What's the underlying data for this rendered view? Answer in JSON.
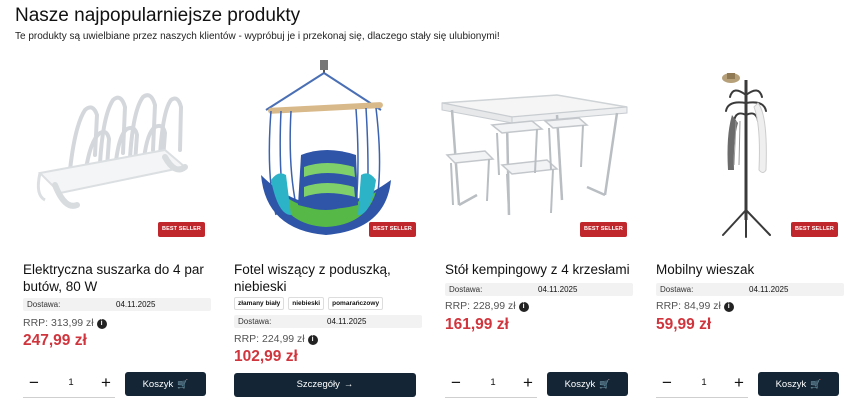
{
  "section": {
    "title": "Nasze najpopularniejsze produkty",
    "subtitle": "Te produkty są uwielbiane przez naszych klientów - wypróbuj je i przekonaj się, dlaczego stały się ulubionymi!"
  },
  "products": [
    {
      "title": "Elektryczna suszarka do 4 par butów, 80 W",
      "badge": "BEST SELLER",
      "delivery_label": "Dostawa:",
      "delivery_date": "04.11.2025",
      "rrp": "RRP: 313,99 zł",
      "price": "247,99 zł",
      "quantity": "1",
      "cart_label": "Koszyk",
      "image_icon": "shoe-dryer-image"
    },
    {
      "title": "Fotel wiszący z poduszką, niebieski",
      "badge": "BEST SELLER",
      "tags": [
        "złamany biały",
        "niebieski",
        "pomarańczowy"
      ],
      "delivery_label": "Dostawa:",
      "delivery_date": "04.11.2025",
      "rrp": "RRP: 224,99 zł",
      "price": "102,99 zł",
      "details_label": "Szczegóły",
      "image_icon": "hanging-chair-image"
    },
    {
      "title": "Stół kempingowy z 4 krzesłami",
      "badge": "BEST SELLER",
      "delivery_label": "Dostawa:",
      "delivery_date": "04.11.2025",
      "rrp": "RRP: 228,99 zł",
      "price": "161,99 zł",
      "quantity": "1",
      "cart_label": "Koszyk",
      "image_icon": "camping-table-image"
    },
    {
      "title": "Mobilny wieszak",
      "badge": "BEST SELLER",
      "delivery_label": "Dostawa:",
      "delivery_date": "04.11.2025",
      "rrp": "RRP: 84,99 zł",
      "price": "59,99 zł",
      "quantity": "1",
      "cart_label": "Koszyk",
      "image_icon": "coat-rack-image"
    }
  ],
  "colors": {
    "price": "#d0353d",
    "button": "#142636",
    "badge": "#c0272d"
  }
}
